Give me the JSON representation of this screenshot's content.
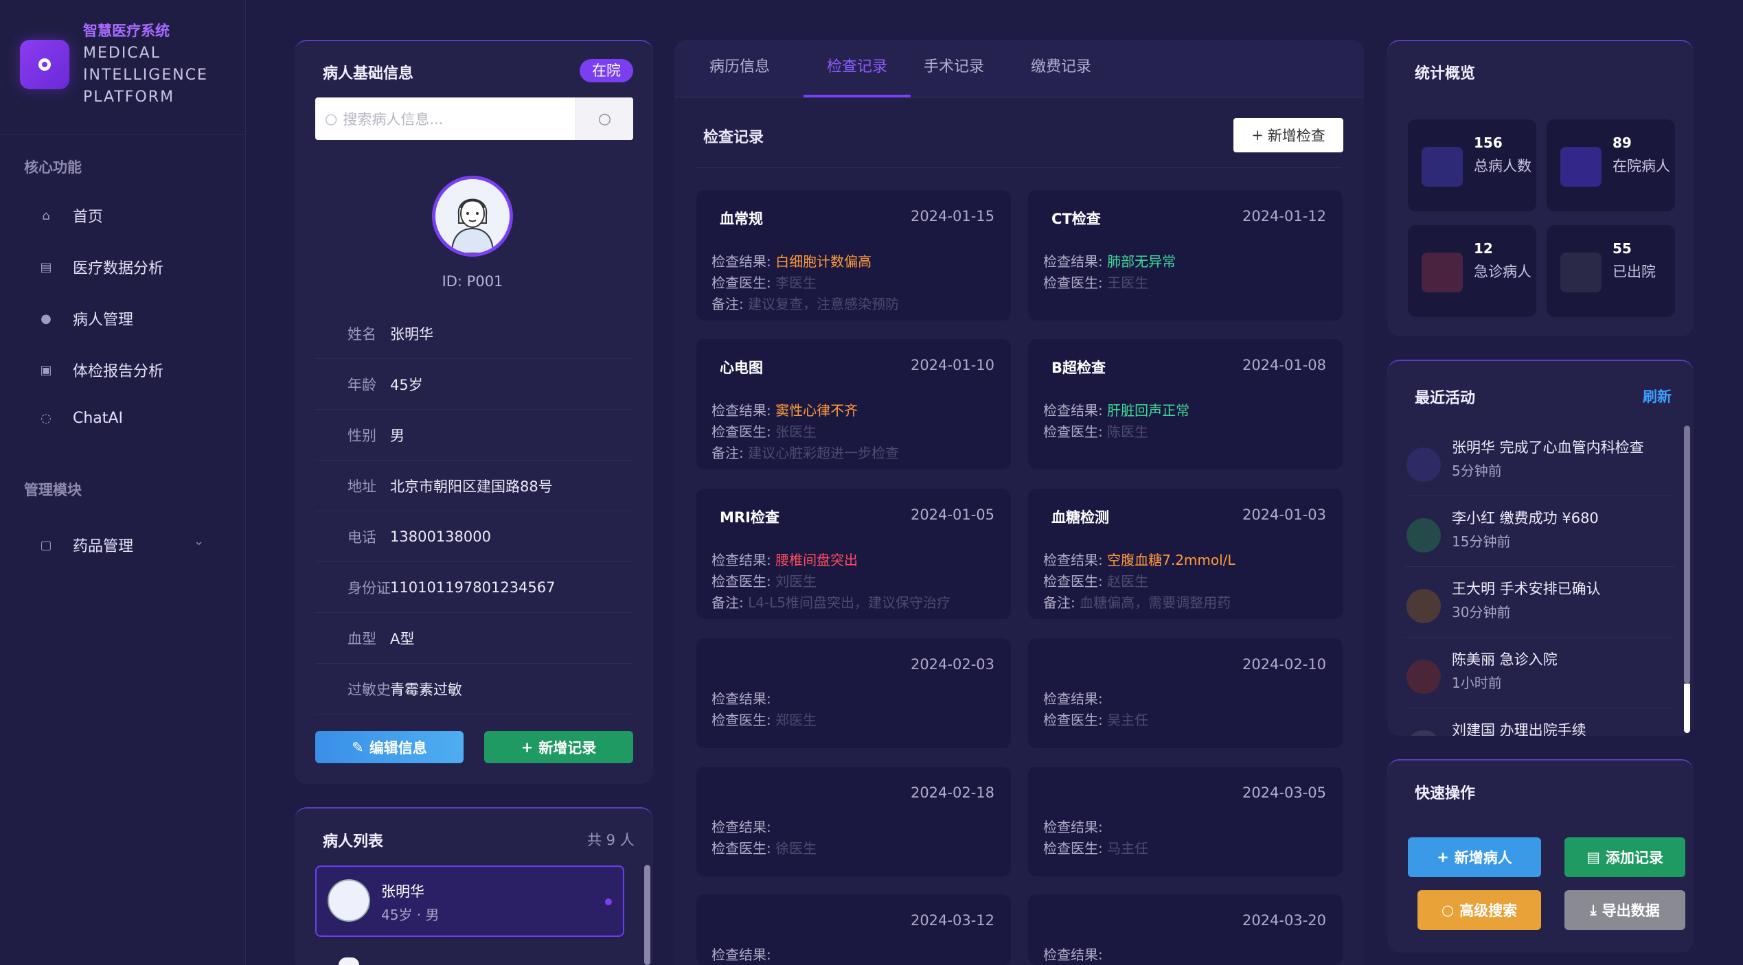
{
  "brand": {
    "cn": "智慧医疗系统",
    "en1": "MEDICAL",
    "en2": "INTELLIGENCE",
    "en3": "PLATFORM"
  },
  "sidebar": {
    "core_title": "核心功能",
    "items": [
      {
        "label": "首页",
        "icon": "home-icon"
      },
      {
        "label": "医疗数据分析",
        "icon": "chart-icon"
      },
      {
        "label": "病人管理",
        "icon": "user-icon"
      },
      {
        "label": "体检报告分析",
        "icon": "report-icon"
      },
      {
        "label": "ChatAI",
        "icon": "chat-icon"
      }
    ],
    "manage_title": "管理模块",
    "manage_items": [
      {
        "label": "药品管理",
        "icon": "medicine-icon"
      }
    ]
  },
  "patient": {
    "title": "病人基础信息",
    "status": "在院",
    "search_placeholder": "搜索病人信息...",
    "id": "ID: P001",
    "fields": [
      {
        "label": "姓名",
        "value": "张明华"
      },
      {
        "label": "年龄",
        "value": "45岁"
      },
      {
        "label": "性别",
        "value": "男"
      },
      {
        "label": "地址",
        "value": "北京市朝阳区建国路88号"
      },
      {
        "label": "电话",
        "value": "13800138000"
      },
      {
        "label": "身份证",
        "value": "110101197801234567"
      },
      {
        "label": "血型",
        "value": "A型"
      },
      {
        "label": "过敏史",
        "value": "青霉素过敏"
      }
    ],
    "edit_label": "编辑信息",
    "add_label": "新增记录"
  },
  "patient_list": {
    "title": "病人列表",
    "count": "共 9 人",
    "items": [
      {
        "name": "张明华",
        "meta": "45岁 · 男"
      }
    ]
  },
  "tabs": [
    "病历信息",
    "检查记录",
    "手术记录",
    "缴费记录"
  ],
  "records": {
    "title": "检查记录",
    "add_label": "新增检查",
    "result_label": "检查结果:",
    "doctor_label": "检查医生:",
    "note_label": "备注:",
    "items": [
      {
        "type": "血常规",
        "date": "2024-01-15",
        "result": "白细胞计数偏高",
        "result_color": "#ff9a3c",
        "doctor": "李医生",
        "note": "建议复查，注意感染预防"
      },
      {
        "type": "CT检查",
        "date": "2024-01-12",
        "result": "肺部无异常",
        "result_color": "#3ddc97",
        "doctor": "王医生",
        "note": ""
      },
      {
        "type": "心电图",
        "date": "2024-01-10",
        "result": "窦性心律不齐",
        "result_color": "#ff9a3c",
        "doctor": "张医生",
        "note": "建议心脏彩超进一步检查"
      },
      {
        "type": "B超检查",
        "date": "2024-01-08",
        "result": "肝脏回声正常",
        "result_color": "#3ddc97",
        "doctor": "陈医生",
        "note": ""
      },
      {
        "type": "MRI检查",
        "date": "2024-01-05",
        "result": "腰椎间盘突出",
        "result_color": "#ff4d5e",
        "doctor": "刘医生",
        "note": "L4-L5椎间盘突出，建议保守治疗"
      },
      {
        "type": "血糖检测",
        "date": "2024-01-03",
        "result": "空腹血糖7.2mmol/L",
        "result_color": "#ff9a3c",
        "doctor": "赵医生",
        "note": "血糖偏高，需要调整用药"
      },
      {
        "type": "",
        "date": "2024-02-03",
        "result": "",
        "result_color": "",
        "doctor": "郑医生",
        "note": ""
      },
      {
        "type": "",
        "date": "2024-02-10",
        "result": "",
        "result_color": "",
        "doctor": "吴主任",
        "note": ""
      },
      {
        "type": "",
        "date": "2024-02-18",
        "result": "",
        "result_color": "",
        "doctor": "徐医生",
        "note": ""
      },
      {
        "type": "",
        "date": "2024-03-05",
        "result": "",
        "result_color": "",
        "doctor": "马主任",
        "note": ""
      },
      {
        "type": "",
        "date": "2024-03-12",
        "result": "",
        "result_color": "",
        "doctor": "",
        "note": ""
      },
      {
        "type": "",
        "date": "2024-03-20",
        "result": "",
        "result_color": "",
        "doctor": "",
        "note": ""
      }
    ]
  },
  "stats": {
    "title": "统计概览",
    "items": [
      {
        "num": "156",
        "label": "总病人数",
        "color": "#2f2a78"
      },
      {
        "num": "89",
        "label": "在院病人",
        "color": "#33288a"
      },
      {
        "num": "12",
        "label": "急诊病人",
        "color": "#4a2340"
      },
      {
        "num": "55",
        "label": "已出院",
        "color": "#2a2a48"
      }
    ]
  },
  "activity": {
    "title": "最近活动",
    "refresh": "刷新",
    "items": [
      {
        "text": "张明华 完成了心血管内科检查",
        "time": "5分钟前",
        "color": "#2e2a66"
      },
      {
        "text": "李小红 缴费成功 ¥680",
        "time": "15分钟前",
        "color": "#244a4a"
      },
      {
        "text": "王大明 手术安排已确认",
        "time": "30分钟前",
        "color": "#4d3a36"
      },
      {
        "text": "陈美丽 急诊入院",
        "time": "1小时前",
        "color": "#4a2638"
      },
      {
        "text": "刘建国 办理出院手续",
        "time": "",
        "color": "#3a3658"
      }
    ]
  },
  "quick": {
    "title": "快速操作",
    "new_patient": "新增病人",
    "add_record": "添加记录",
    "search": "高级搜索",
    "export": "导出数据"
  }
}
